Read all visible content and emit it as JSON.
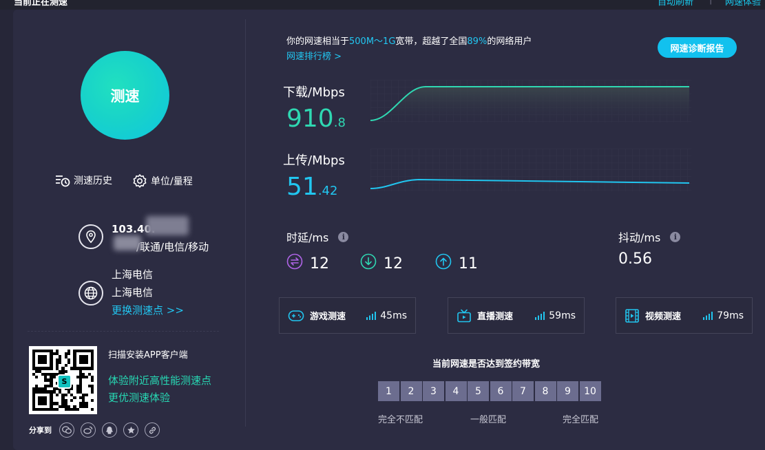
{
  "top": {
    "left_cut_text": "当前正在测速",
    "right_link_1": "自动刷新",
    "right_link_2": "网速体验"
  },
  "main": {
    "speed_button_label": "测速"
  },
  "tools": {
    "history": "测速历史",
    "unit": "单位/量程"
  },
  "network": {
    "ip_partial": "103.40.",
    "isp_partial": "/联通/电信/移动",
    "server_line_1": "上海电信",
    "server_line_2": "上海电信",
    "change_server": "更换测速点 >>"
  },
  "app": {
    "scan_text": "扫描安装APP客户端",
    "line_1": "体验附近高性能测速点",
    "line_2": "更优测速体验",
    "share_label": "分享到"
  },
  "summary": {
    "prefix": "你的网速相当于",
    "bandwidth": "500M～1G",
    "middle": "宽带，超越了全国",
    "percent": "89%",
    "suffix": "的网络用户",
    "rank_link": "网速排行榜 >"
  },
  "diag_button": "网速诊断报告",
  "download": {
    "label": "下载/Mbps",
    "int": "910",
    "dec": ".8"
  },
  "upload": {
    "label": "上传/Mbps",
    "int": "51",
    "dec": ".42"
  },
  "latency": {
    "label": "时延/ms",
    "values": [
      "12",
      "12",
      "11"
    ]
  },
  "jitter": {
    "label": "抖动/ms",
    "value": "0.56"
  },
  "cards": [
    {
      "label": "游戏测速",
      "ms": "45ms"
    },
    {
      "label": "直播测速",
      "ms": "59ms"
    },
    {
      "label": "视频测速",
      "ms": "79ms"
    }
  ],
  "bandwidth_check": {
    "title": "当前网速是否达到签约带宽",
    "scale": [
      "1",
      "2",
      "3",
      "4",
      "5",
      "6",
      "7",
      "8",
      "9",
      "10"
    ],
    "low": "完全不匹配",
    "mid": "一般匹配",
    "high": "完全匹配"
  },
  "colors": {
    "download": "#2fd8b2",
    "upload": "#21c6f0",
    "accent": "#12c1ee",
    "latency_icon": "#b064e8"
  }
}
